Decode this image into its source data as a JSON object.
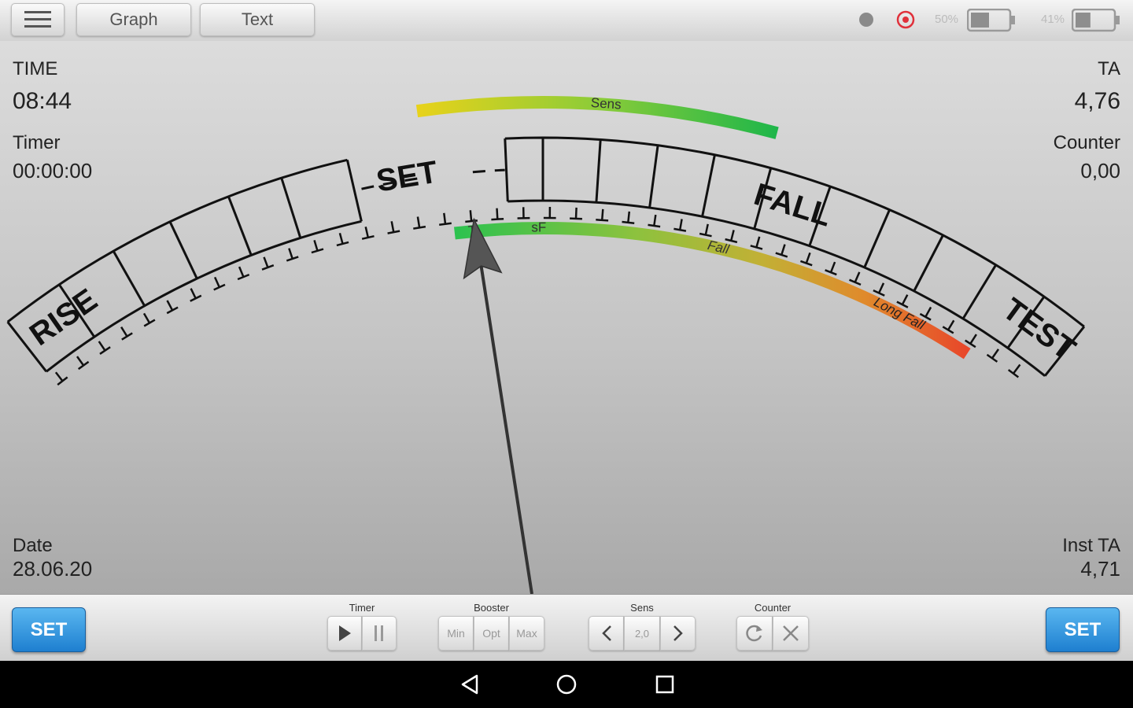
{
  "topbar": {
    "tabs": [
      {
        "label": "Graph"
      },
      {
        "label": "Text"
      }
    ],
    "battery1_percent": "50%",
    "battery1_level": 0.5,
    "battery2_percent": "41%",
    "battery2_level": 0.41,
    "status_dot_icon": "record-dot-icon",
    "target_icon": "target-icon"
  },
  "readouts": {
    "time_label": "TIME",
    "time_value": "08:44",
    "timer_label": "Timer",
    "timer_value": "00:00:00",
    "date_label": "Date",
    "date_value": "28.06.20",
    "ta_label": "TA",
    "ta_value": "4,76",
    "counter_label": "Counter",
    "counter_value": "0,00",
    "inst_ta_label": "Inst TA",
    "inst_ta_value": "4,71"
  },
  "dial": {
    "rise_label": "RISE",
    "set_label": "SET",
    "fall_label": "FALL",
    "test_label": "TEST",
    "sens_label": "Sens",
    "t_label": "T",
    "sf_label": "sF",
    "fall_zone_label": "Fall",
    "long_fall_label": "Long Fall",
    "needle_angle_deg": -5
  },
  "bottombar": {
    "set_left": "SET",
    "set_right": "SET",
    "timer_title": "Timer",
    "booster_title": "Booster",
    "booster_options": [
      "Min",
      "Opt",
      "Max"
    ],
    "sens_title": "Sens",
    "sens_value": "2,0",
    "counter_title": "Counter"
  },
  "colors": {
    "set_button": "#2a8ee0",
    "sens_arc_start": "#e8d21a",
    "sens_arc_end": "#1eb64a",
    "fall_arc_start": "#2cc24f",
    "fall_arc_end": "#e04a2a",
    "record_red": "#e0303a"
  }
}
